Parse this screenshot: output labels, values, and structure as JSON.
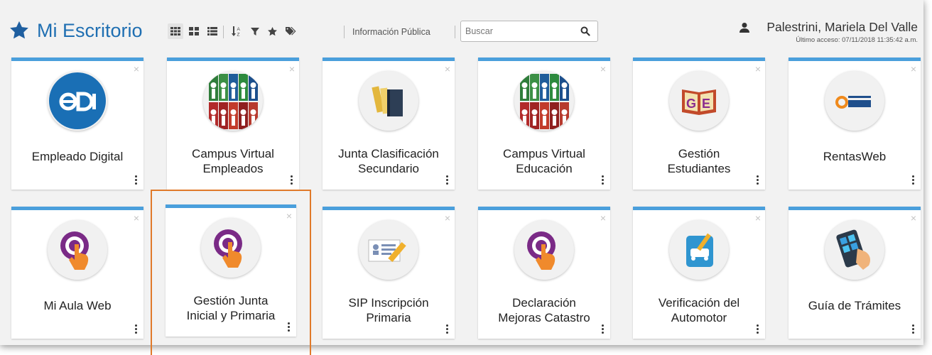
{
  "header": {
    "title": "Mi Escritorio",
    "info_link": "Información Pública",
    "search_placeholder": "Buscar",
    "user_name": "Palestrini, Mariela Del Valle",
    "last_access": "Último acceso: 07/11/2018 11:35:42 a.m.",
    "brand_color": "#1f6fb2"
  },
  "toolbar": {
    "icons": [
      "grid-large-icon",
      "grid-small-icon",
      "list-icon",
      "sort-az-icon",
      "filter-icon",
      "star-icon",
      "tag-icon"
    ]
  },
  "tiles": [
    {
      "label_lines": [
        "Empleado Digital"
      ],
      "icon": "edi-logo-icon"
    },
    {
      "label_lines": [
        "Campus Virtual",
        "Empleados"
      ],
      "icon": "campus-people-icon"
    },
    {
      "label_lines": [
        "Junta Clasificación",
        "Secundario"
      ],
      "icon": "books-icon"
    },
    {
      "label_lines": [
        "Campus Virtual",
        "Educación"
      ],
      "icon": "campus-people-icon"
    },
    {
      "label_lines": [
        "Gestión",
        "Estudiantes"
      ],
      "icon": "ge-logo-icon"
    },
    {
      "label_lines": [
        "RentasWeb"
      ],
      "icon": "rentas-logo-icon"
    },
    {
      "label_lines": [
        "Mi Aula Web"
      ],
      "icon": "touch-hand-icon"
    },
    {
      "label_lines": [
        "Gestión Junta",
        "Inicial y Primaria"
      ],
      "icon": "touch-hand-icon"
    },
    {
      "label_lines": [
        "SIP Inscripción",
        "Primaria"
      ],
      "icon": "form-pencil-icon"
    },
    {
      "label_lines": [
        "Declaración",
        "Mejoras Catastro"
      ],
      "icon": "touch-hand-icon"
    },
    {
      "label_lines": [
        "Verificación del",
        "Automotor"
      ],
      "icon": "car-check-icon"
    },
    {
      "label_lines": [
        "Guía de Trámites"
      ],
      "icon": "tablet-hand-icon"
    }
  ],
  "tile_close_glyph": "×",
  "highlight_color": "#e07a2a",
  "tile_accent_color": "#4a9fdc"
}
